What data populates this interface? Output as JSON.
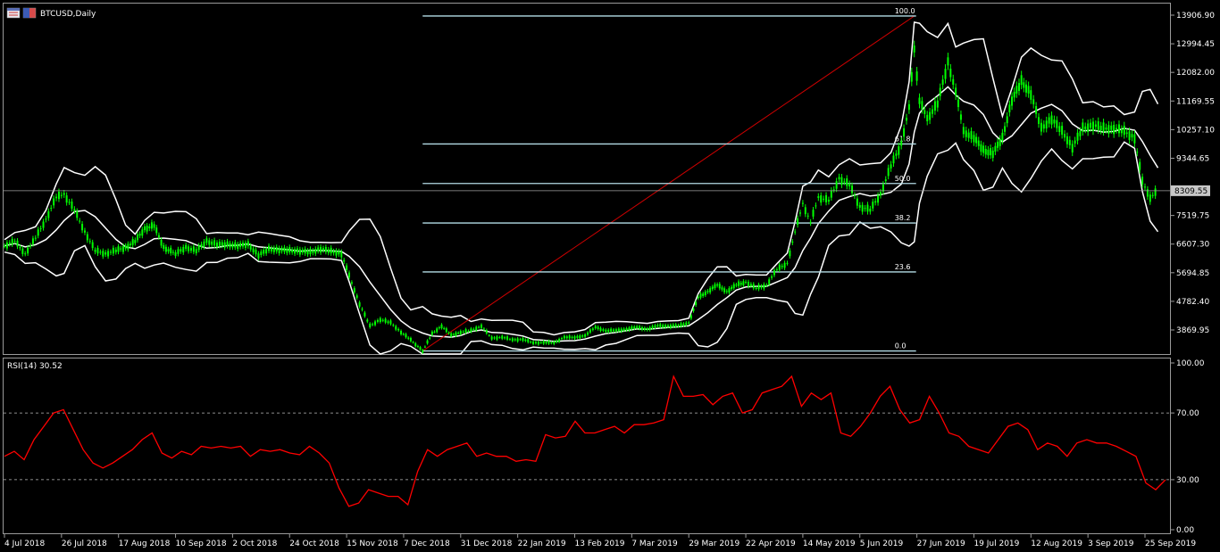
{
  "window": {
    "symbol_title": "BTCUSD,Daily"
  },
  "indicator": {
    "label": "RSI(14) 30.52",
    "levels": [
      "70.00",
      "30.00"
    ]
  },
  "current_price": "8309.55",
  "colors": {
    "background": "#000000",
    "candle": "#00ff00",
    "bands": "#ffffff",
    "fib_levels": "#b4dce6",
    "trend_line": "#cc0000",
    "rsi": "#ff0000"
  },
  "chart_data": [
    {
      "type": "candlestick",
      "title": "BTCUSD,Daily",
      "price_tick_labels": [
        "13906.90",
        "12994.45",
        "12082.00",
        "11169.55",
        "10257.10",
        "9344.65",
        "8309.55",
        "7519.75",
        "6607.30",
        "5694.85",
        "4782.40",
        "3869.95"
      ],
      "date_tick_labels": [
        "4 Jul 2018",
        "26 Jul 2018",
        "17 Aug 2018",
        "10 Sep 2018",
        "2 Oct 2018",
        "24 Oct 2018",
        "15 Nov 2018",
        "7 Dec 2018",
        "31 Dec 2018",
        "22 Jan 2019",
        "13 Feb 2019",
        "7 Mar 2019",
        "29 Mar 2019",
        "22 Apr 2019",
        "14 May 2019",
        "5 Jun 2019",
        "27 Jun 2019",
        "19 Jul 2019",
        "12 Aug 2019",
        "3 Sep 2019",
        "25 Sep 2019"
      ],
      "ylim": [
        3150,
        13906.9
      ],
      "grid": false,
      "indicators": [
        "Bollinger Bands",
        "Fibonacci retracement"
      ],
      "fibonacci": {
        "start": {
          "date": "15 Dec 2018",
          "price": 3200
        },
        "end": {
          "date": "26 Jun 2019",
          "price": 13880
        },
        "levels": [
          {
            "label": "100.0",
            "price": 13880
          },
          {
            "label": "61.8",
            "price": 9800
          },
          {
            "label": "50.0",
            "price": 8540
          },
          {
            "label": "38.2",
            "price": 7280
          },
          {
            "label": "23.6",
            "price": 5720
          },
          {
            "label": "0.0",
            "price": 3200
          }
        ]
      },
      "close_series": [
        {
          "date": "4 Jul 2018",
          "close": 6550
        },
        {
          "date": "8 Jul 2018",
          "close": 6700
        },
        {
          "date": "12 Jul 2018",
          "close": 6300
        },
        {
          "date": "16 Jul 2018",
          "close": 6800
        },
        {
          "date": "20 Jul 2018",
          "close": 7400
        },
        {
          "date": "24 Jul 2018",
          "close": 8100
        },
        {
          "date": "27 Jul 2018",
          "close": 8200
        },
        {
          "date": "31 Jul 2018",
          "close": 7700
        },
        {
          "date": "4 Aug 2018",
          "close": 7000
        },
        {
          "date": "8 Aug 2018",
          "close": 6400
        },
        {
          "date": "12 Aug 2018",
          "close": 6300
        },
        {
          "date": "16 Aug 2018",
          "close": 6400
        },
        {
          "date": "20 Aug 2018",
          "close": 6500
        },
        {
          "date": "24 Aug 2018",
          "close": 6700
        },
        {
          "date": "28 Aug 2018",
          "close": 7100
        },
        {
          "date": "1 Sep 2018",
          "close": 7200
        },
        {
          "date": "5 Sep 2018",
          "close": 6500
        },
        {
          "date": "10 Sep 2018",
          "close": 6300
        },
        {
          "date": "14 Sep 2018",
          "close": 6500
        },
        {
          "date": "18 Sep 2018",
          "close": 6400
        },
        {
          "date": "22 Sep 2018",
          "close": 6700
        },
        {
          "date": "26 Sep 2018",
          "close": 6600
        },
        {
          "date": "30 Sep 2018",
          "close": 6600
        },
        {
          "date": "4 Oct 2018",
          "close": 6550
        },
        {
          "date": "8 Oct 2018",
          "close": 6600
        },
        {
          "date": "12 Oct 2018",
          "close": 6250
        },
        {
          "date": "16 Oct 2018",
          "close": 6450
        },
        {
          "date": "20 Oct 2018",
          "close": 6420
        },
        {
          "date": "24 Oct 2018",
          "close": 6410
        },
        {
          "date": "28 Oct 2018",
          "close": 6380
        },
        {
          "date": "1 Nov 2018",
          "close": 6350
        },
        {
          "date": "5 Nov 2018",
          "close": 6450
        },
        {
          "date": "9 Nov 2018",
          "close": 6380
        },
        {
          "date": "13 Nov 2018",
          "close": 6300
        },
        {
          "date": "16 Nov 2018",
          "close": 5600
        },
        {
          "date": "20 Nov 2018",
          "close": 4700
        },
        {
          "date": "24 Nov 2018",
          "close": 4000
        },
        {
          "date": "28 Nov 2018",
          "close": 4200
        },
        {
          "date": "2 Dec 2018",
          "close": 4100
        },
        {
          "date": "6 Dec 2018",
          "close": 3800
        },
        {
          "date": "10 Dec 2018",
          "close": 3550
        },
        {
          "date": "15 Dec 2018",
          "close": 3200
        },
        {
          "date": "19 Dec 2018",
          "close": 3750
        },
        {
          "date": "23 Dec 2018",
          "close": 4000
        },
        {
          "date": "27 Dec 2018",
          "close": 3700
        },
        {
          "date": "31 Dec 2018",
          "close": 3800
        },
        {
          "date": "4 Jan 2019",
          "close": 3850
        },
        {
          "date": "8 Jan 2019",
          "close": 4000
        },
        {
          "date": "12 Jan 2019",
          "close": 3600
        },
        {
          "date": "16 Jan 2019",
          "close": 3650
        },
        {
          "date": "20 Jan 2019",
          "close": 3550
        },
        {
          "date": "24 Jan 2019",
          "close": 3580
        },
        {
          "date": "28 Jan 2019",
          "close": 3450
        },
        {
          "date": "1 Feb 2019",
          "close": 3480
        },
        {
          "date": "5 Feb 2019",
          "close": 3450
        },
        {
          "date": "9 Feb 2019",
          "close": 3650
        },
        {
          "date": "13 Feb 2019",
          "close": 3620
        },
        {
          "date": "17 Feb 2019",
          "close": 3700
        },
        {
          "date": "21 Feb 2019",
          "close": 3950
        },
        {
          "date": "25 Feb 2019",
          "close": 3850
        },
        {
          "date": "1 Mar 2019",
          "close": 3850
        },
        {
          "date": "5 Mar 2019",
          "close": 3900
        },
        {
          "date": "9 Mar 2019",
          "close": 3950
        },
        {
          "date": "13 Mar 2019",
          "close": 3900
        },
        {
          "date": "17 Mar 2019",
          "close": 4000
        },
        {
          "date": "21 Mar 2019",
          "close": 4000
        },
        {
          "date": "25 Mar 2019",
          "close": 4000
        },
        {
          "date": "29 Mar 2019",
          "close": 4100
        },
        {
          "date": "2 Apr 2019",
          "close": 4900
        },
        {
          "date": "6 Apr 2019",
          "close": 5100
        },
        {
          "date": "10 Apr 2019",
          "close": 5300
        },
        {
          "date": "14 Apr 2019",
          "close": 5100
        },
        {
          "date": "18 Apr 2019",
          "close": 5300
        },
        {
          "date": "22 Apr 2019",
          "close": 5400
        },
        {
          "date": "26 Apr 2019",
          "close": 5200
        },
        {
          "date": "30 Apr 2019",
          "close": 5300
        },
        {
          "date": "4 May 2019",
          "close": 5800
        },
        {
          "date": "8 May 2019",
          "close": 6000
        },
        {
          "date": "11 May 2019",
          "close": 7000
        },
        {
          "date": "14 May 2019",
          "close": 7900
        },
        {
          "date": "17 May 2019",
          "close": 7300
        },
        {
          "date": "20 May 2019",
          "close": 8100
        },
        {
          "date": "24 May 2019",
          "close": 8000
        },
        {
          "date": "28 May 2019",
          "close": 8700
        },
        {
          "date": "1 Jun 2019",
          "close": 8500
        },
        {
          "date": "5 Jun 2019",
          "close": 7800
        },
        {
          "date": "9 Jun 2019",
          "close": 7700
        },
        {
          "date": "13 Jun 2019",
          "close": 8200
        },
        {
          "date": "17 Jun 2019",
          "close": 9100
        },
        {
          "date": "21 Jun 2019",
          "close": 9800
        },
        {
          "date": "24 Jun 2019",
          "close": 11000
        },
        {
          "date": "26 Jun 2019",
          "close": 12800
        },
        {
          "date": "28 Jun 2019",
          "close": 11200
        },
        {
          "date": "1 Jul 2019",
          "close": 10600
        },
        {
          "date": "5 Jul 2019",
          "close": 11100
        },
        {
          "date": "9 Jul 2019",
          "close": 12400
        },
        {
          "date": "12 Jul 2019",
          "close": 11500
        },
        {
          "date": "15 Jul 2019",
          "close": 10200
        },
        {
          "date": "19 Jul 2019",
          "close": 10000
        },
        {
          "date": "23 Jul 2019",
          "close": 9600
        },
        {
          "date": "27 Jul 2019",
          "close": 9500
        },
        {
          "date": "31 Jul 2019",
          "close": 10000
        },
        {
          "date": "4 Aug 2019",
          "close": 11200
        },
        {
          "date": "8 Aug 2019",
          "close": 11800
        },
        {
          "date": "12 Aug 2019",
          "close": 11400
        },
        {
          "date": "16 Aug 2019",
          "close": 10300
        },
        {
          "date": "20 Aug 2019",
          "close": 10600
        },
        {
          "date": "24 Aug 2019",
          "close": 10200
        },
        {
          "date": "28 Aug 2019",
          "close": 9700
        },
        {
          "date": "1 Sep 2019",
          "close": 10300
        },
        {
          "date": "5 Sep 2019",
          "close": 10400
        },
        {
          "date": "9 Sep 2019",
          "close": 10300
        },
        {
          "date": "13 Sep 2019",
          "close": 10300
        },
        {
          "date": "17 Sep 2019",
          "close": 10200
        },
        {
          "date": "21 Sep 2019",
          "close": 10000
        },
        {
          "date": "24 Sep 2019",
          "close": 8600
        },
        {
          "date": "27 Sep 2019",
          "close": 8100
        },
        {
          "date": "30 Sep 2019",
          "close": 8300
        }
      ]
    },
    {
      "type": "line",
      "title": "RSI(14) 30.52",
      "y_tick_labels": [
        "100.00",
        "70.00",
        "30.00",
        "0.00"
      ],
      "ylim": [
        0,
        100
      ],
      "reference_lines": [
        70,
        30
      ],
      "series": [
        {
          "name": "RSI(14)",
          "values": [
            44,
            47,
            42,
            54,
            62,
            70,
            72,
            60,
            48,
            40,
            37,
            40,
            44,
            48,
            54,
            58,
            46,
            43,
            47,
            45,
            50,
            49,
            50,
            49,
            50,
            44,
            48,
            47,
            48,
            46,
            45,
            50,
            46,
            40,
            25,
            14,
            16,
            24,
            22,
            20,
            20,
            15,
            35,
            48,
            44,
            48,
            50,
            52,
            44,
            46,
            44,
            44,
            41,
            42,
            41,
            57,
            55,
            56,
            65,
            58,
            58,
            60,
            62,
            58,
            63,
            63,
            64,
            66,
            92,
            80,
            80,
            81,
            75,
            80,
            82,
            70,
            72,
            82,
            84,
            86,
            92,
            74,
            82,
            78,
            82,
            58,
            56,
            62,
            70,
            80,
            86,
            72,
            64,
            66,
            80,
            70,
            58,
            56,
            50,
            48,
            46,
            54,
            62,
            64,
            60,
            48,
            52,
            50,
            44,
            52,
            54,
            52,
            52,
            50,
            47,
            44,
            28,
            24,
            30
          ]
        }
      ]
    }
  ]
}
